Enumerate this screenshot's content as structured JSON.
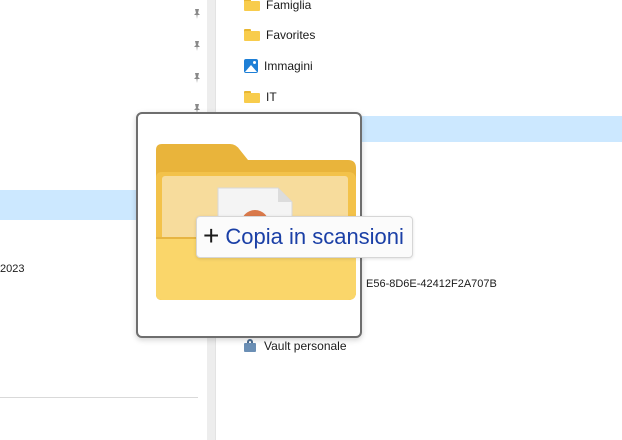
{
  "left_pane": {
    "date_fragment": "2023"
  },
  "right_pane": {
    "items": [
      {
        "label": "Famiglia",
        "icon": "folder-icon"
      },
      {
        "label": "Favorites",
        "icon": "folder-icon"
      },
      {
        "label": "Immagini",
        "icon": "pictures-icon"
      },
      {
        "label": "IT",
        "icon": "folder-icon"
      }
    ],
    "guid_fragment": "E56-8D6E-42412F2A707B",
    "vault": {
      "label": "Vault personale",
      "icon": "personal-vault-icon"
    }
  },
  "drag": {
    "action": "Copia in",
    "target": "scansioni",
    "plus_symbol": "+"
  },
  "colors": {
    "selection": "#cce8ff",
    "folder": "#f8cc4c",
    "tooltip_text": "#1a3fa6"
  }
}
